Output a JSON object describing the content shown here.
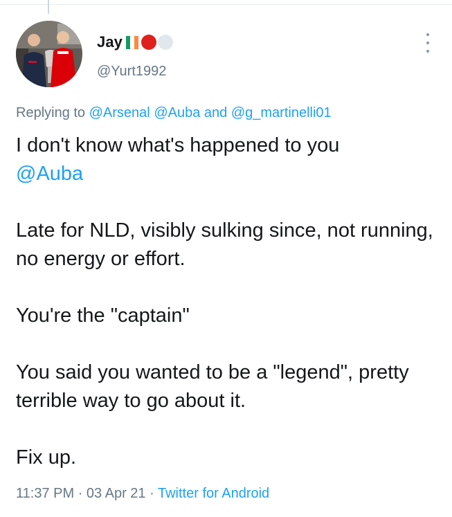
{
  "user": {
    "display_name": "Jay",
    "handle": "@Yurt1992",
    "flag_colors": [
      "#169b62",
      "#ffffff",
      "#ff883e"
    ],
    "emoji_red": "#e0201c",
    "emoji_white": "#e1e8ed",
    "avatar_icon": "profile-photo"
  },
  "reply": {
    "prefix": "Replying to",
    "mention_1": "@Arsenal",
    "mention_2": "@Auba",
    "conjunction": "and",
    "mention_3": "@g_martinelli01"
  },
  "tweet": {
    "line_1": "I don't know what's happened to you",
    "mention": "@Auba",
    "para_2": "Late for NLD, visibly sulking since, not running, no energy or effort.",
    "para_3": "You're the \"captain\"",
    "para_4": "You said you wanted to be a \"legend\", pretty terrible way to go about it.",
    "para_5": "Fix up."
  },
  "meta": {
    "time": "11:37 PM",
    "sep_1": "·",
    "date": "03 Apr 21",
    "sep_2": "·",
    "source": "Twitter for Android"
  },
  "colors": {
    "link": "#1da1f2",
    "secondary_text": "#657786",
    "primary_text": "#14171a"
  },
  "icons": {
    "more": "more-vertical-icon"
  }
}
